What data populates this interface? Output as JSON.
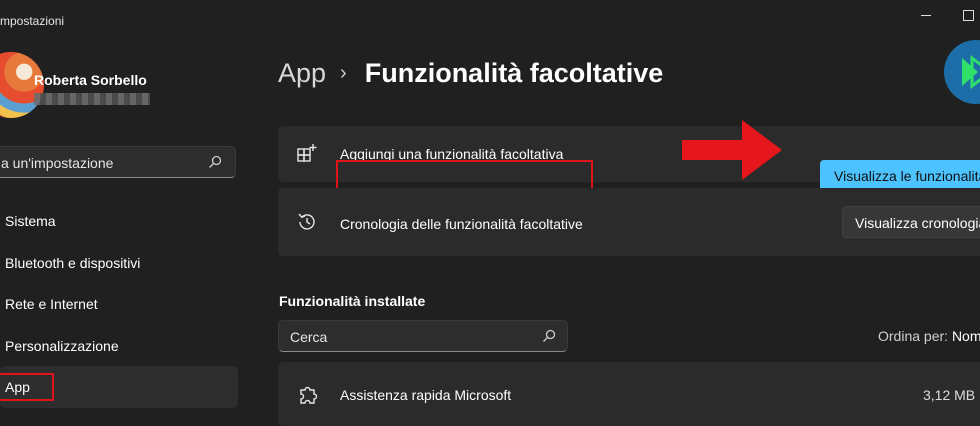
{
  "window": {
    "title": "mpostazioni"
  },
  "user": {
    "name": "Roberta Sorbello"
  },
  "sidebar": {
    "search_placeholder": "a un'impostazione",
    "items": [
      {
        "label": "Sistema"
      },
      {
        "label": "Bluetooth e dispositivi"
      },
      {
        "label": "Rete e Internet"
      },
      {
        "label": "Personalizzazione"
      },
      {
        "label": "App"
      }
    ]
  },
  "main": {
    "breadcrumb": {
      "parent": "App",
      "current": "Funzionalità facoltative"
    },
    "cards": [
      {
        "label": "Aggiungi una funzionalità facoltativa",
        "button": "Visualizza le funzionalità"
      },
      {
        "label": "Cronologia delle funzionalità facoltative",
        "button": "Visualizza cronologia"
      }
    ],
    "installed": {
      "title": "Funzionalità installate",
      "search_placeholder": "Cerca",
      "sort_label": "Ordina per:",
      "sort_value": "Nom",
      "items": [
        {
          "name": "Assistenza rapida Microsoft",
          "size": "3,12 MB"
        }
      ]
    }
  },
  "colors": {
    "accent": "#4cc2ff",
    "highlight": "#e0121a",
    "background": "#202020",
    "card": "#2b2b2b"
  }
}
